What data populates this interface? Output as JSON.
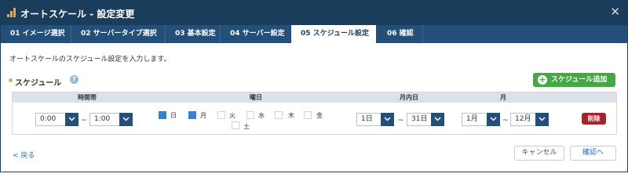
{
  "window": {
    "title": "オートスケール - 設定変更",
    "close_glyph": "✕"
  },
  "tabs": [
    {
      "label": "01 イメージ選択"
    },
    {
      "label": "02 サーバータイプ選択"
    },
    {
      "label": "03 基本設定"
    },
    {
      "label": "04 サーバー設定"
    },
    {
      "label": "05 スケジュール設定"
    },
    {
      "label": "06 確認"
    }
  ],
  "active_tab": "05 スケジュール設定",
  "intro_text": "オートスケールのスケジュール設定を入力します。",
  "schedule": {
    "title": "スケジュール",
    "help_glyph": "?",
    "add_button": "スケジュール追加",
    "add_icon": "+",
    "headers": {
      "time": "時間帯",
      "weekday": "曜日",
      "day_of_month": "月内日",
      "month": "月"
    },
    "row": {
      "time_from": "0:00",
      "time_to": "1:00",
      "tilde": "~",
      "weekdays": [
        {
          "label": "日",
          "checked": true
        },
        {
          "label": "月",
          "checked": true
        },
        {
          "label": "火",
          "checked": false
        },
        {
          "label": "水",
          "checked": false
        },
        {
          "label": "木",
          "checked": false
        },
        {
          "label": "金",
          "checked": false
        },
        {
          "label": "土",
          "checked": false
        }
      ],
      "day_from": "1日",
      "day_to": "31日",
      "month_from": "1月",
      "month_to": "12月",
      "delete_button": "削除"
    }
  },
  "footer": {
    "back": "< 戻る",
    "cancel": "キャンセル",
    "confirm": "確認へ"
  },
  "colors": {
    "titlebar": "#1a3d5c",
    "tabbar": "#244f79",
    "add_button": "#45a845",
    "delete_button": "#a8212b",
    "checkbox_on": "#3a7fd0",
    "link": "#2a6bb5"
  }
}
